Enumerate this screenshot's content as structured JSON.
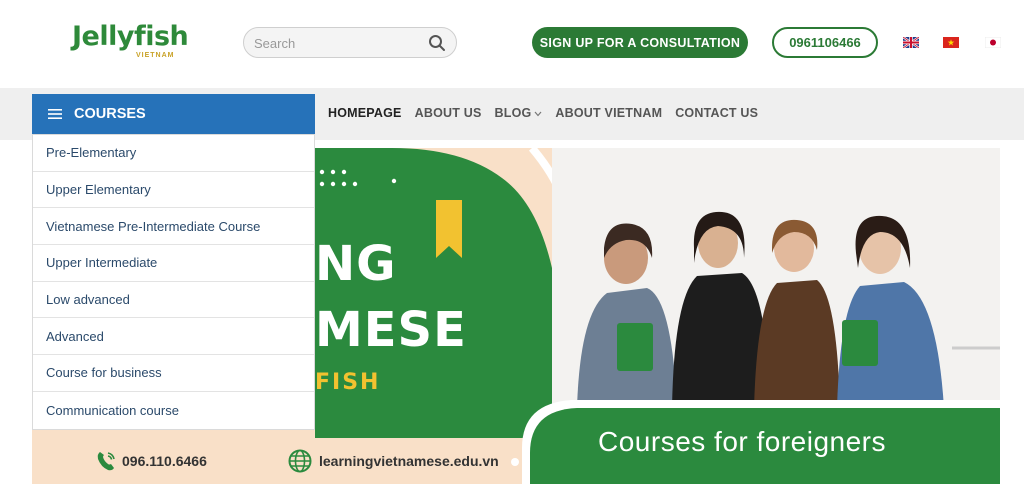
{
  "header": {
    "logo_text": "Jellyfish",
    "logo_subtext": "VIETNAM",
    "search_placeholder": "Search",
    "consult_label": "SIGN UP FOR A CONSULTATION",
    "phone_label": "0961106466",
    "flags": [
      "flag-uk-icon",
      "flag-vietnam-icon",
      "flag-japan-icon"
    ]
  },
  "nav": {
    "courses_label": "COURSES",
    "links": [
      {
        "label": "HOMEPAGE",
        "active": true
      },
      {
        "label": "ABOUT US"
      },
      {
        "label": "BLOG"
      },
      {
        "label": "ABOUT VIETNAM"
      },
      {
        "label": "CONTACT US"
      }
    ]
  },
  "menu": {
    "items": [
      "Pre-Elementary",
      "Upper Elementary",
      "Vietnamese Pre-Intermediate Course",
      "Upper Intermediate",
      "Low advanced",
      "Advanced",
      "Course for business",
      "Communication course"
    ]
  },
  "banner": {
    "headline_line1": "NG",
    "headline_line2": "MESE",
    "headline_line3": "FISH",
    "tagline": "Courses for foreigners",
    "phone": "096.110.6466",
    "website": "learningvietnamese.edu.vn"
  },
  "colors": {
    "brand_green": "#2b7a35",
    "courses_blue": "#2672b9",
    "banner_peach": "#f9e0c8"
  }
}
